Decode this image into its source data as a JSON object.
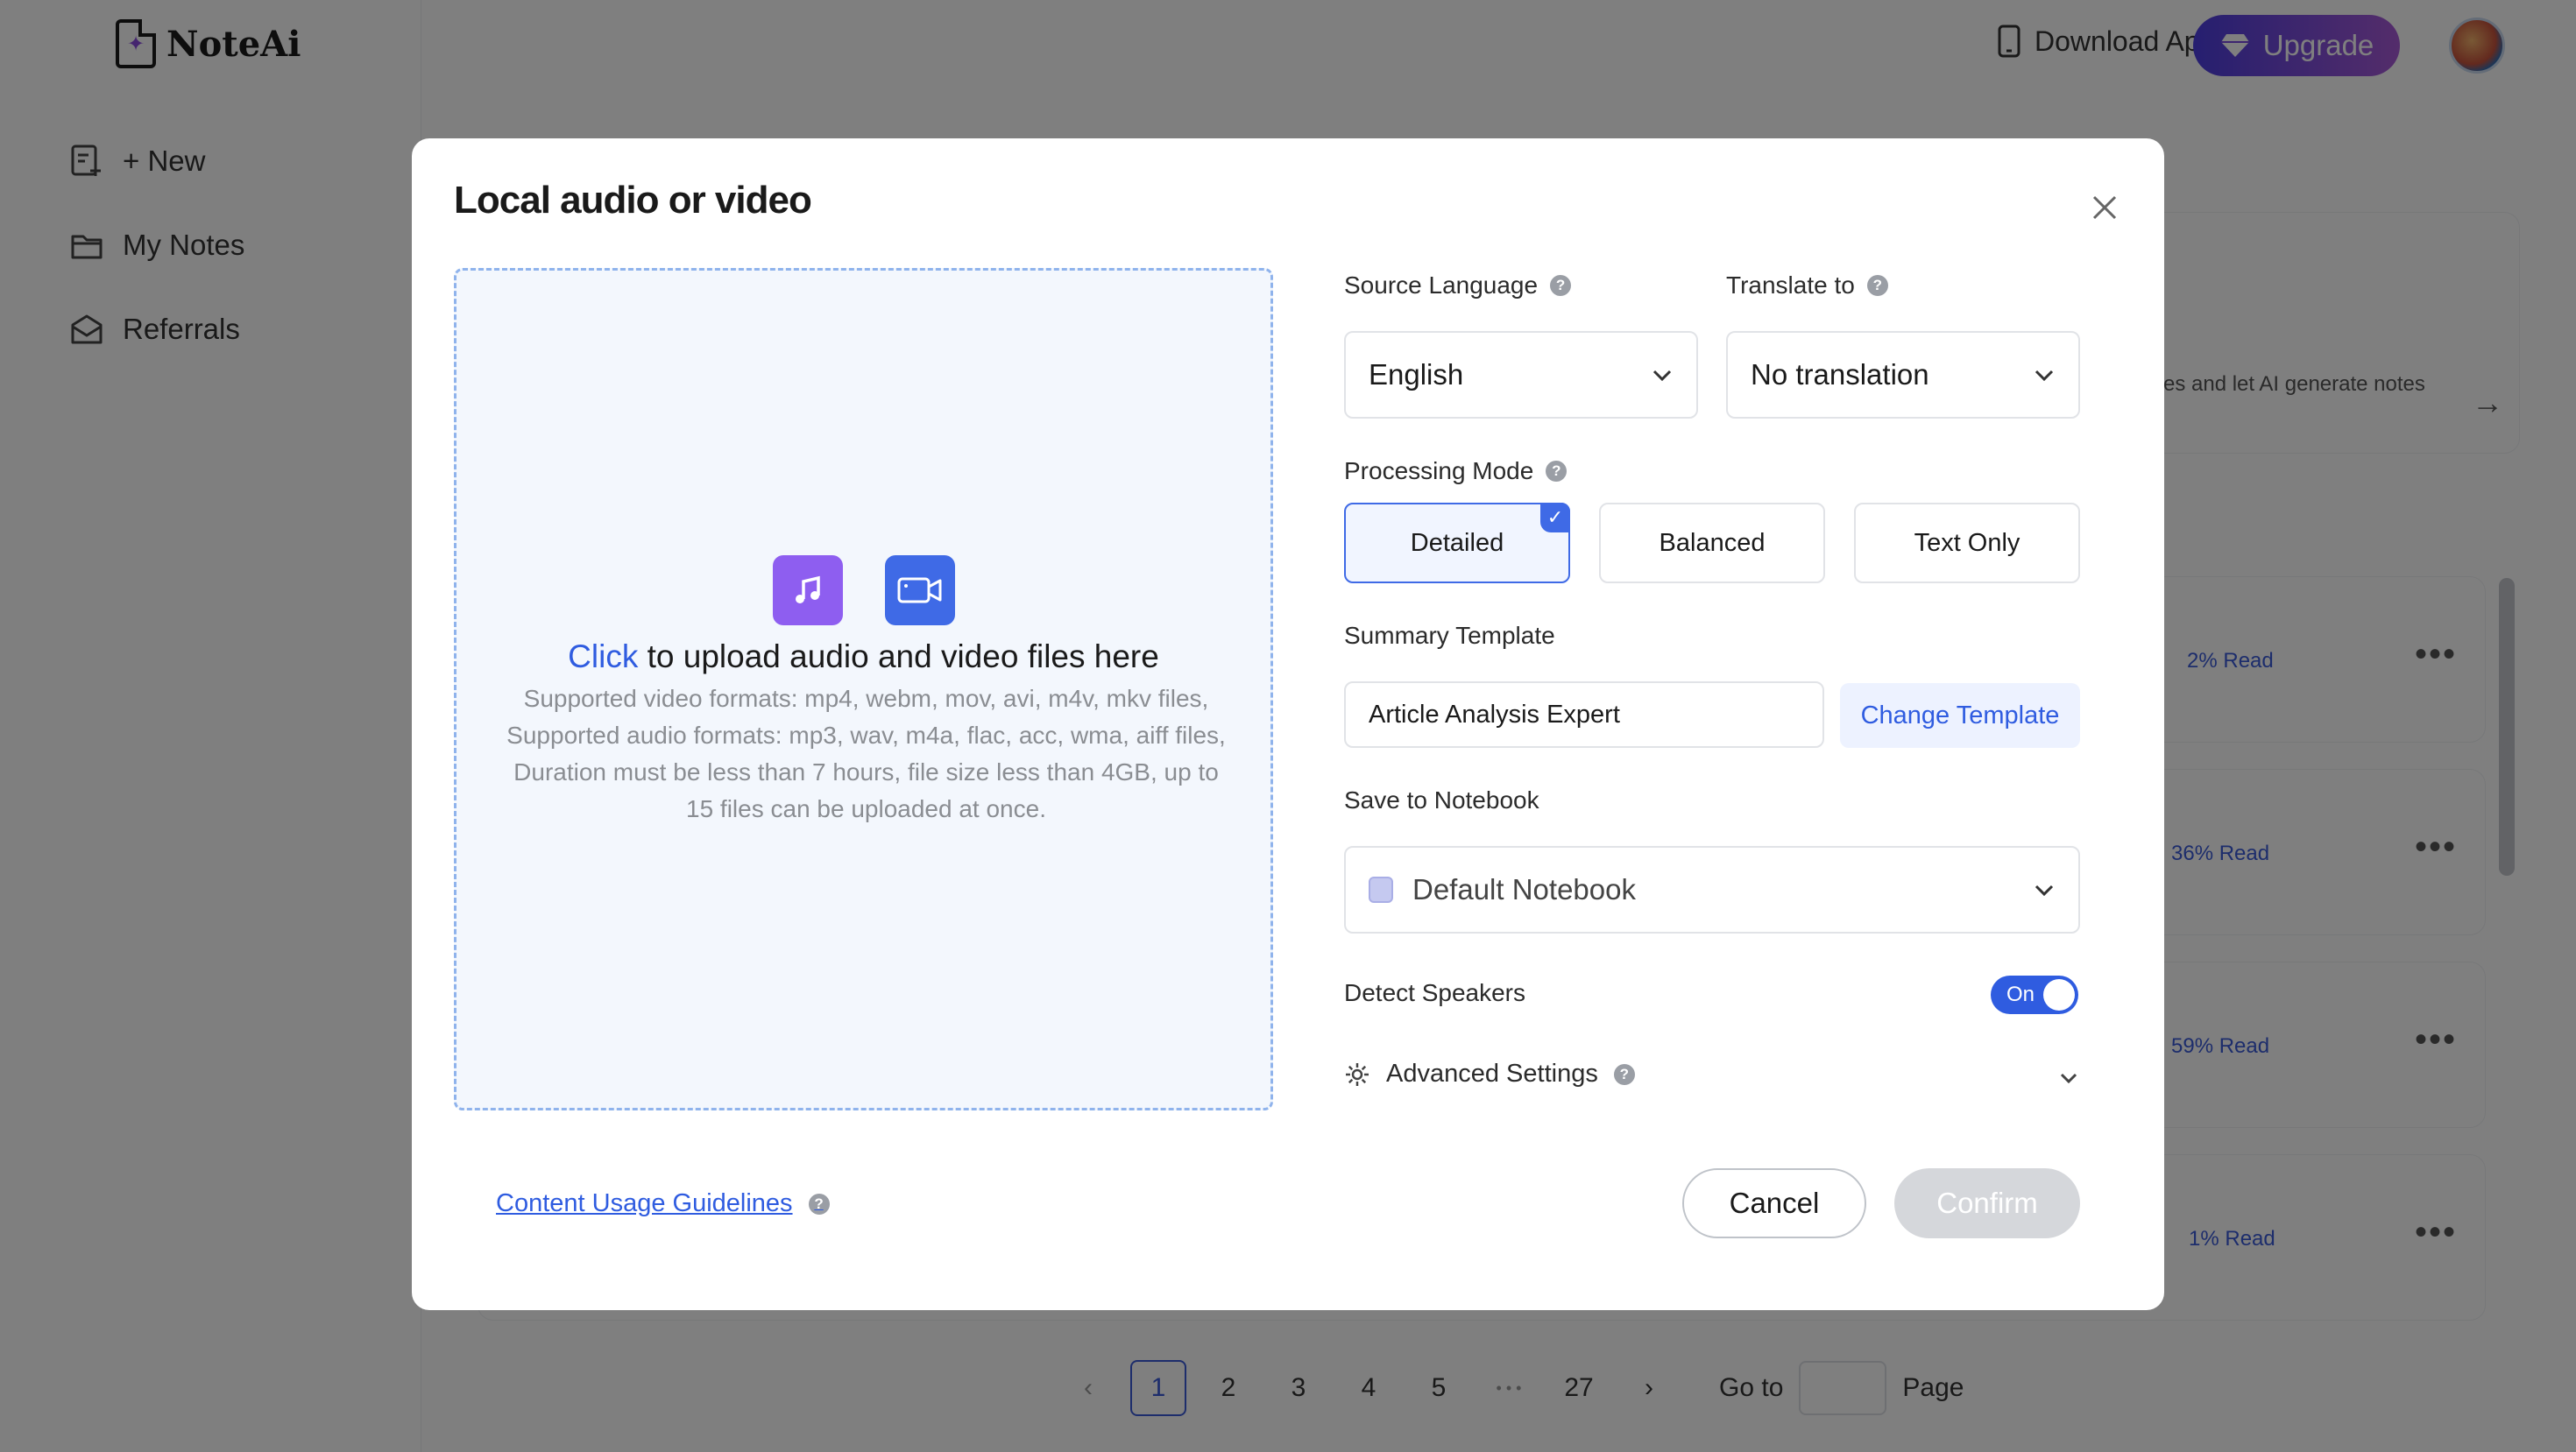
{
  "app": {
    "logo_text": "NoteAi",
    "nav": [
      {
        "label": "+ New",
        "icon": "new-note-icon"
      },
      {
        "label": "My Notes",
        "icon": "folder-icon"
      },
      {
        "label": "Referrals",
        "icon": "referral-mail-icon"
      }
    ],
    "topbar": {
      "download_label": "Download App",
      "upgrade_label": "Upgrade"
    },
    "background_snippet": "ses and let AI generate notes",
    "notes": [
      {
        "progress_label": "2% Read"
      },
      {
        "progress_label": "36% Read"
      },
      {
        "progress_label": "59% Read"
      },
      {
        "progress_label": "1% Read"
      }
    ],
    "pagination": {
      "pages": [
        "1",
        "2",
        "3",
        "4",
        "5"
      ],
      "ellipsis": "• • •",
      "last_page": "27",
      "current": "1",
      "goto_label": "Go to",
      "page_label": "Page"
    }
  },
  "modal": {
    "title": "Local audio or video",
    "upload": {
      "click_text": "Click",
      "headline_rest": " to upload audio and video files here",
      "description": "Supported video formats: mp4, webm, mov, avi, m4v, mkv files, Supported audio formats: mp3, wav, m4a, flac, acc, wma, aiff files, Duration must be less than 7 hours, file size less than 4GB, up to 15 files can be uploaded at once."
    },
    "source_language": {
      "label": "Source Language",
      "value": "English"
    },
    "translate_to": {
      "label": "Translate to",
      "value": "No translation"
    },
    "processing_mode": {
      "label": "Processing Mode",
      "options": [
        "Detailed",
        "Balanced",
        "Text Only"
      ],
      "selected": "Detailed"
    },
    "summary_template": {
      "label": "Summary Template",
      "value": "Article Analysis Expert",
      "change_label": "Change Template"
    },
    "save_to_notebook": {
      "label": "Save to Notebook",
      "value": "Default Notebook"
    },
    "detect_speakers": {
      "label": "Detect Speakers",
      "toggle_text": "On",
      "enabled": true
    },
    "advanced_settings": {
      "label": "Advanced Settings"
    },
    "footer": {
      "guidelines_label": "Content Usage Guidelines",
      "cancel_label": "Cancel",
      "confirm_label": "Confirm"
    }
  },
  "colors": {
    "accent": "#2f5ce0",
    "audio_icon_bg": "#8e5ef0",
    "video_icon_bg": "#3f6ae6",
    "overlay": "rgba(0,0,0,0.5)",
    "confirm_disabled": "#d5d7db"
  }
}
